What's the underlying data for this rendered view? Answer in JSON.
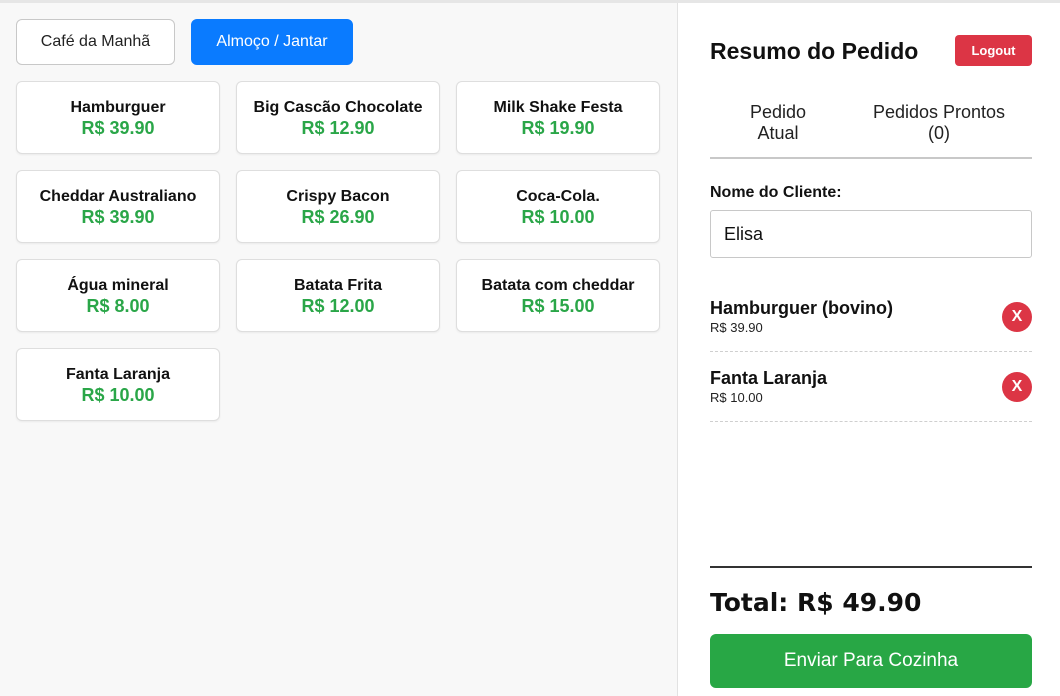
{
  "menu": {
    "categories": [
      "Café da Manhã",
      "Almoço / Jantar"
    ],
    "active_category": "Almoço / Jantar",
    "active_color": "#0a7bff",
    "price_color": "#2aa648",
    "products": [
      {
        "name": "Hamburguer",
        "price": "R$ 39.90"
      },
      {
        "name": "Big Cascão Chocolate",
        "price": "R$ 12.90"
      },
      {
        "name": "Milk Shake Festa",
        "price": "R$ 19.90"
      },
      {
        "name": "Cheddar Australiano",
        "price": "R$ 39.90"
      },
      {
        "name": "Crispy Bacon",
        "price": "R$ 26.90"
      },
      {
        "name": "Coca-Cola.",
        "price": "R$ 10.00"
      },
      {
        "name": "Água mineral",
        "price": "R$ 8.00"
      },
      {
        "name": "Batata Frita",
        "price": "R$ 12.00"
      },
      {
        "name": "Batata com cheddar",
        "price": "R$ 15.00"
      },
      {
        "name": "Fanta Laranja",
        "price": "R$ 10.00"
      }
    ]
  },
  "summary": {
    "title": "Resumo do Pedido",
    "logout_label": "Logout",
    "tabs": [
      "Pedido Atual",
      "Pedidos Prontos (0)"
    ],
    "client_label": "Nome do Cliente:",
    "client_name": "Elisa",
    "items": [
      {
        "name": "Hamburguer (bovino)",
        "price": "R$ 39.90",
        "remove": "X"
      },
      {
        "name": "Fanta Laranja",
        "price": "R$ 10.00",
        "remove": "X"
      }
    ],
    "total": "Total: R$ 49.90",
    "send_label": "Enviar Para Cozinha",
    "send_color": "#28a745",
    "danger_color": "#dc3545"
  }
}
